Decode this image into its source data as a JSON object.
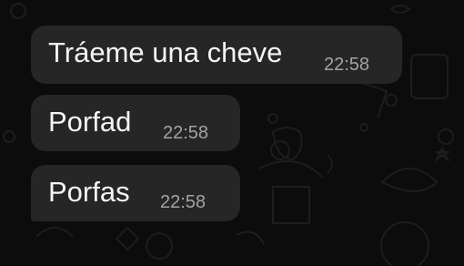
{
  "messages": [
    {
      "text": "Tráeme una cheve",
      "time": "22:58"
    },
    {
      "text": "Porfad",
      "time": "22:58"
    },
    {
      "text": "Porfas",
      "time": "22:58"
    }
  ],
  "colors": {
    "background": "#0c0c0c",
    "bubble": "#262626",
    "text": "#f4f4f4",
    "timestamp": "#a3a3a3",
    "doodle": "#1c1c1c"
  },
  "icons": [
    "chat-wallpaper-doodles"
  ]
}
